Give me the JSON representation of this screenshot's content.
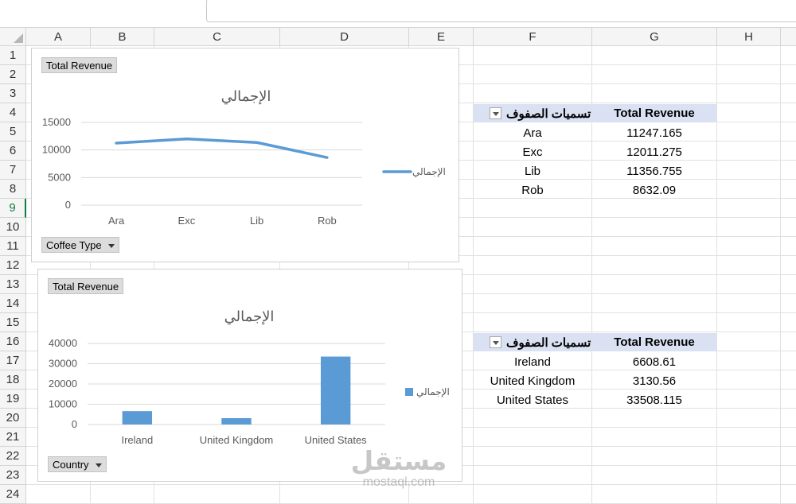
{
  "sheet": {
    "columns": [
      "A",
      "B",
      "C",
      "D",
      "E",
      "F",
      "G",
      "H"
    ],
    "rows": [
      "1",
      "2",
      "3",
      "4",
      "5",
      "6",
      "7",
      "8",
      "9",
      "10",
      "11",
      "12",
      "13",
      "14",
      "15",
      "16",
      "17",
      "18",
      "19",
      "20",
      "21",
      "22",
      "23",
      "24"
    ],
    "selected_row": "9"
  },
  "pivot_coffee": {
    "row_label_header": "تسميات الصفوف",
    "value_header": "Total Revenue",
    "rows": [
      {
        "label": "Ara",
        "value": "11247.165"
      },
      {
        "label": "Exc",
        "value": "12011.275"
      },
      {
        "label": "Lib",
        "value": "11356.755"
      },
      {
        "label": "Rob",
        "value": "8632.09"
      }
    ]
  },
  "pivot_country": {
    "row_label_header": "تسميات الصفوف",
    "value_header": "Total Revenue",
    "rows": [
      {
        "label": "Ireland",
        "value": "6608.61"
      },
      {
        "label": "United Kingdom",
        "value": "3130.56"
      },
      {
        "label": "United States",
        "value": "33508.115"
      }
    ]
  },
  "chart_data": [
    {
      "type": "line",
      "title": "الإجمالي",
      "field_button_value": "Total Revenue",
      "field_button_axis": "Coffee Type",
      "categories": [
        "Ara",
        "Exc",
        "Lib",
        "Rob"
      ],
      "series": [
        {
          "name": "الإجمالي",
          "values": [
            11247.165,
            12011.275,
            11356.755,
            8632.09
          ]
        }
      ],
      "ylim": [
        0,
        15000
      ],
      "yticks": [
        0,
        5000,
        10000,
        15000
      ],
      "grid": true,
      "legend_position": "right",
      "color": "#5b9bd5"
    },
    {
      "type": "bar",
      "title": "الإجمالي",
      "field_button_value": "Total Revenue",
      "field_button_axis": "Country",
      "categories": [
        "Ireland",
        "United Kingdom",
        "United States"
      ],
      "series": [
        {
          "name": "الإجمالي",
          "values": [
            6608.61,
            3130.56,
            33508.115
          ]
        }
      ],
      "ylim": [
        0,
        40000
      ],
      "yticks": [
        0,
        10000,
        20000,
        30000,
        40000
      ],
      "grid": true,
      "legend_position": "right",
      "color": "#5b9bd5"
    }
  ],
  "watermark": {
    "main": "مستقل",
    "sub": "mostaql.com"
  }
}
